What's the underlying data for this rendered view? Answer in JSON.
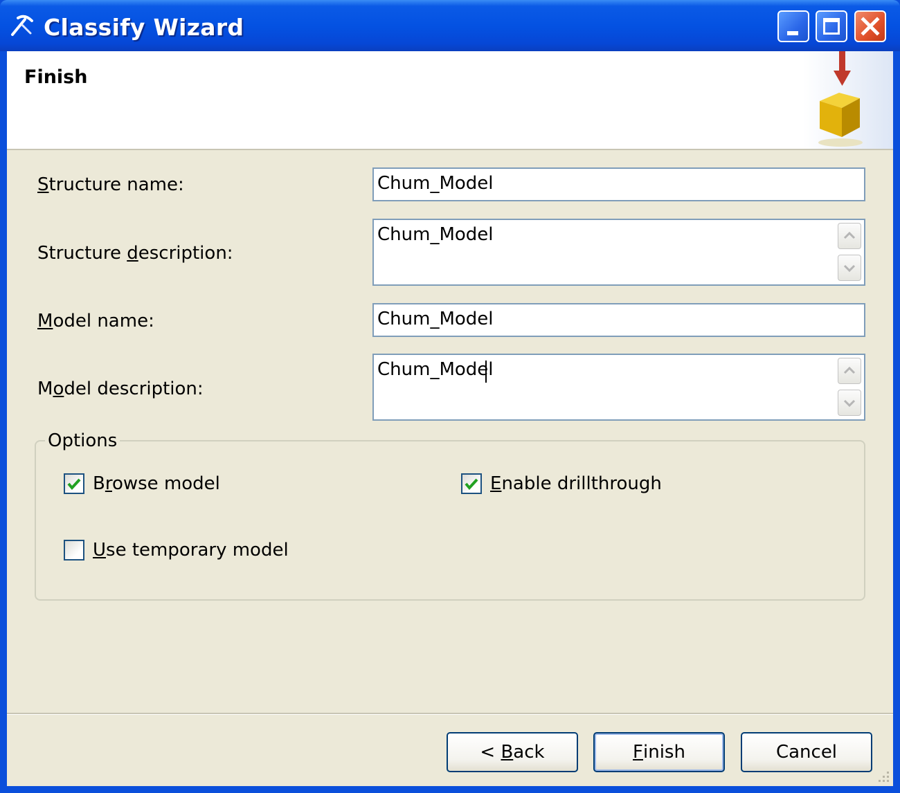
{
  "window": {
    "title": "Classify Wizard",
    "controls": {
      "minimize": "minimize",
      "maximize": "maximize",
      "close": "close"
    }
  },
  "header": {
    "title": "Finish"
  },
  "form": {
    "structure_name": {
      "label_pre": "",
      "label_key": "S",
      "label_post": "tructure name:",
      "value": "Chum_Model"
    },
    "structure_description": {
      "label_pre": "Structure ",
      "label_key": "d",
      "label_post": "escription:",
      "value": "Chum_Model"
    },
    "model_name": {
      "label_pre": "",
      "label_key": "M",
      "label_post": "odel name:",
      "value": "Chum_Model"
    },
    "model_description": {
      "label_pre": "M",
      "label_key": "o",
      "label_post": "del description:",
      "value": "Chum_Model"
    }
  },
  "options": {
    "title": "Options",
    "browse_model": {
      "label_pre": "B",
      "label_key": "r",
      "label_post": "owse model",
      "checked": true
    },
    "enable_drillthrough": {
      "label_pre": "",
      "label_key": "E",
      "label_post": "nable drillthrough",
      "checked": true
    },
    "use_temporary_model": {
      "label_pre": "",
      "label_key": "U",
      "label_post": "se temporary model",
      "checked": false
    }
  },
  "buttons": {
    "back": {
      "pre": "< ",
      "key": "B",
      "post": "ack"
    },
    "finish": {
      "pre": "",
      "key": "F",
      "post": "inish"
    },
    "cancel": {
      "label": "Cancel"
    }
  },
  "colors": {
    "titlebar": "#0452e2",
    "client_bg": "#ece9d8",
    "close_button": "#e0502a",
    "checkmark": "#21a121"
  },
  "icons": [
    "wizard-app-icon",
    "mining-model-cube-icon",
    "scroll-up-icon",
    "scroll-down-icon",
    "checkmark-icon",
    "resize-grip-icon"
  ]
}
